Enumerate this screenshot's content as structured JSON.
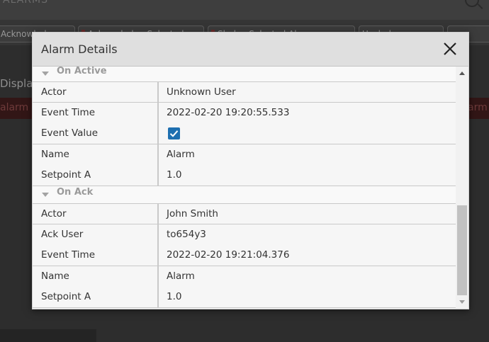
{
  "background": {
    "top_title": "ALARMS",
    "chips": [
      "Acknowledge",
      "Acknowledge Selected",
      "Shelve Selected Alarms",
      "Unshelve",
      ""
    ],
    "display_label": "Display",
    "band_left": "alarm",
    "band_right": "arm"
  },
  "modal": {
    "title": "Alarm Details",
    "close_icon": "close-icon",
    "sections": [
      {
        "label": "On Active",
        "rows": [
          {
            "key": "Actor",
            "value": "Unknown User"
          },
          {
            "key": "Event Time",
            "value": "2022-02-20 19:20:55.533"
          },
          {
            "key": "Event Value",
            "value": "",
            "checked": true
          },
          {
            "key": "Name",
            "value": "Alarm"
          },
          {
            "key": "Setpoint A",
            "value": "1.0"
          }
        ]
      },
      {
        "label": "On Ack",
        "rows": [
          {
            "key": "Actor",
            "value": "John Smith"
          },
          {
            "key": "Ack User",
            "value": "to654y3"
          },
          {
            "key": "Event Time",
            "value": "2022-02-20 19:21:04.376"
          },
          {
            "key": "Name",
            "value": "Alarm"
          },
          {
            "key": "Setpoint A",
            "value": "1.0"
          }
        ]
      }
    ]
  },
  "colors": {
    "checkbox": "#1e6fb0",
    "header_bg": "#dfdfdf",
    "background_band": "#321616"
  }
}
